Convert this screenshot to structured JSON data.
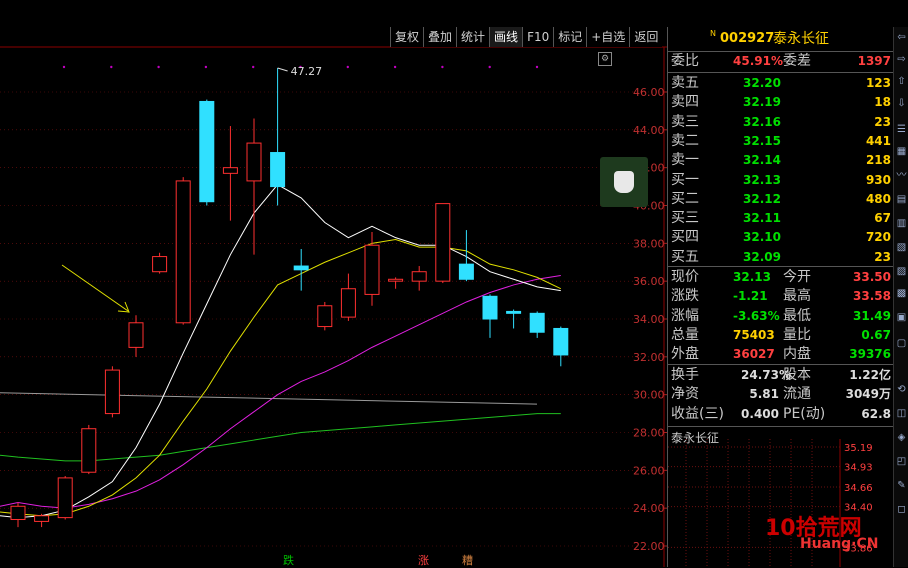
{
  "toolbar": {
    "buttons": [
      "复权",
      "叠加",
      "统计",
      "画线",
      "F10",
      "标记",
      "+自选",
      "返回"
    ],
    "active_index": 3
  },
  "header": {
    "badge": "N",
    "code": "002927",
    "name": "泰永长征"
  },
  "chart_data": {
    "type": "candlestick",
    "y_axis_ticks": [
      "46.00",
      "44.00",
      "42.00",
      "40.00",
      "38.00",
      "36.00",
      "34.00",
      "32.00",
      "30.00",
      "28.00",
      "26.00",
      "24.00",
      "22.00"
    ],
    "ylim": [
      21.5,
      47.5
    ],
    "max_annotation": "47.27",
    "candles": [
      {
        "o": 23.4,
        "c": 24.1,
        "h": 24.3,
        "l": 23.0
      },
      {
        "o": 23.3,
        "c": 23.6,
        "h": 23.7,
        "l": 23.0
      },
      {
        "o": 23.5,
        "c": 25.6,
        "h": 25.7,
        "l": 23.4
      },
      {
        "o": 25.9,
        "c": 28.2,
        "h": 28.4,
        "l": 25.8
      },
      {
        "o": 29.0,
        "c": 31.3,
        "h": 31.5,
        "l": 28.8
      },
      {
        "o": 32.5,
        "c": 33.8,
        "h": 34.2,
        "l": 32.0
      },
      {
        "o": 36.5,
        "c": 37.3,
        "h": 37.5,
        "l": 36.4
      },
      {
        "o": 33.8,
        "c": 41.3,
        "h": 41.5,
        "l": 33.7
      },
      {
        "o": 45.5,
        "c": 40.2,
        "h": 45.6,
        "l": 40.0
      },
      {
        "o": 41.7,
        "c": 42.0,
        "h": 44.2,
        "l": 39.2
      },
      {
        "o": 41.3,
        "c": 43.3,
        "h": 44.6,
        "l": 37.4
      },
      {
        "o": 42.8,
        "c": 41.0,
        "h": 47.27,
        "l": 40.0
      },
      {
        "o": 36.8,
        "c": 36.6,
        "h": 37.7,
        "l": 35.5
      },
      {
        "o": 33.6,
        "c": 34.7,
        "h": 34.9,
        "l": 33.4
      },
      {
        "o": 34.1,
        "c": 35.6,
        "h": 36.4,
        "l": 33.9
      },
      {
        "o": 35.3,
        "c": 37.9,
        "h": 38.6,
        "l": 34.7
      },
      {
        "o": 36.0,
        "c": 36.1,
        "h": 36.2,
        "l": 35.6
      },
      {
        "o": 36.0,
        "c": 36.5,
        "h": 36.8,
        "l": 35.5
      },
      {
        "o": 36.0,
        "c": 40.1,
        "h": 40.1,
        "l": 35.9
      },
      {
        "o": 36.9,
        "c": 36.1,
        "h": 38.7,
        "l": 36.0
      },
      {
        "o": 35.2,
        "c": 34.0,
        "h": 35.3,
        "l": 33.0
      },
      {
        "o": 34.4,
        "c": 34.3,
        "h": 34.5,
        "l": 33.5
      },
      {
        "o": 34.3,
        "c": 33.3,
        "h": 34.4,
        "l": 33.0
      },
      {
        "o": 33.5,
        "c": 32.1,
        "h": 33.6,
        "l": 31.5
      }
    ],
    "ma_white": [
      23.5,
      23.6,
      23.9,
      24.6,
      25.4,
      27.2,
      29.5,
      32.2,
      34.8,
      37.4,
      39.6,
      41.1,
      40.4,
      39.1,
      38.3,
      38.9,
      38.3,
      37.9,
      37.9,
      37.3,
      36.5,
      36.1,
      35.7,
      35.5
    ],
    "ma_yellow": [
      23.7,
      23.6,
      23.7,
      24.1,
      24.7,
      25.6,
      26.8,
      28.6,
      30.3,
      32.3,
      34.1,
      35.8,
      36.4,
      37.0,
      37.5,
      38.0,
      38.2,
      37.8,
      37.8,
      37.6,
      36.9,
      36.6,
      36.2,
      35.6
    ],
    "ma_magenta": [
      24.3,
      24.1,
      24.0,
      24.2,
      24.5,
      24.9,
      25.5,
      26.3,
      27.2,
      28.2,
      29.1,
      30.0,
      30.7,
      31.2,
      31.8,
      32.5,
      33.1,
      33.7,
      34.3,
      34.9,
      35.4,
      35.8,
      36.1,
      36.3
    ],
    "ma_gray_start": 30.1,
    "ma_gray_end": 29.5,
    "ma_green": [
      26.7,
      26.6,
      26.5,
      26.5,
      26.6,
      26.7,
      26.8,
      27.0,
      27.2,
      27.4,
      27.6,
      27.8,
      28.0,
      28.1,
      28.2,
      28.3,
      28.4,
      28.5,
      28.6,
      28.7,
      28.8,
      28.9,
      29.0,
      29.0
    ],
    "bottom_marks": [
      "跌",
      "涨",
      "糟"
    ]
  },
  "quote": {
    "weibi_label": "委比",
    "weibi": "45.91%",
    "weicha_label": "委差",
    "weicha": "1397",
    "asks": [
      {
        "label": "卖五",
        "price": "32.20",
        "vol": "123"
      },
      {
        "label": "卖四",
        "price": "32.19",
        "vol": "18"
      },
      {
        "label": "卖三",
        "price": "32.16",
        "vol": "23"
      },
      {
        "label": "卖二",
        "price": "32.15",
        "vol": "441"
      },
      {
        "label": "卖一",
        "price": "32.14",
        "vol": "218"
      }
    ],
    "bids": [
      {
        "label": "买一",
        "price": "32.13",
        "vol": "930"
      },
      {
        "label": "买二",
        "price": "32.12",
        "vol": "480"
      },
      {
        "label": "买三",
        "price": "32.11",
        "vol": "67"
      },
      {
        "label": "买四",
        "price": "32.10",
        "vol": "720"
      },
      {
        "label": "买五",
        "price": "32.09",
        "vol": "23"
      }
    ],
    "stats": [
      {
        "l1": "现价",
        "v1": "32.13",
        "c1": "#00e000",
        "l2": "今开",
        "v2": "33.50",
        "c2": "#ff4040"
      },
      {
        "l1": "涨跌",
        "v1": "-1.21",
        "c1": "#00e000",
        "l2": "最高",
        "v2": "33.58",
        "c2": "#ff4040"
      },
      {
        "l1": "涨幅",
        "v1": "-3.63%",
        "c1": "#00e000",
        "l2": "最低",
        "v2": "31.49",
        "c2": "#00e000"
      },
      {
        "l1": "总量",
        "v1": "75403",
        "c1": "#ffd000",
        "l2": "量比",
        "v2": "0.67",
        "c2": "#00e000"
      },
      {
        "l1": "外盘",
        "v1": "36027",
        "c1": "#ff4040",
        "l2": "内盘",
        "v2": "39376",
        "c2": "#00e000"
      }
    ],
    "fund": [
      {
        "l1": "换手",
        "v1": "24.73%",
        "l2": "股本",
        "v2": "1.22亿"
      },
      {
        "l1": "净资",
        "v1": "5.81",
        "l2": "流通",
        "v2": "3049万"
      },
      {
        "l1": "收益(三)",
        "v1": "0.400",
        "l2": "PE(动)",
        "v2": "62.8"
      }
    ],
    "sub_title": "泰永长征",
    "sub_ticks": [
      "35.19",
      "34.93",
      "34.66",
      "34.40",
      "33.86"
    ]
  },
  "watermark": {
    "main": "10拾荒网",
    "sub": "Huang·CN"
  }
}
